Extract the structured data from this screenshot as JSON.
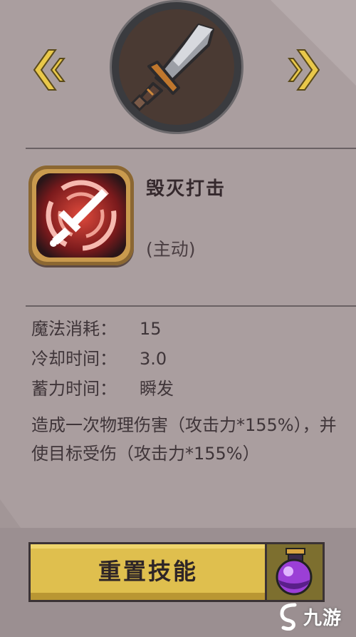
{
  "colors": {
    "background": "#aa9e9f",
    "button_gold": "#dfbf4e",
    "arrow_gold": "#e9c84a",
    "skill_red": "#c8322e"
  },
  "selector": {
    "prev_icon": "chevron-double-left-icon",
    "next_icon": "chevron-double-right-icon",
    "weapon_icon": "sword-icon"
  },
  "skill": {
    "icon": "sword-strike-icon",
    "name": "毁灭打击",
    "type": "(主动)"
  },
  "stats": [
    {
      "label": "魔法消耗：",
      "value": "15"
    },
    {
      "label": "冷却时间：",
      "value": "3.0"
    },
    {
      "label": "蓄力时间：",
      "value": "瞬发"
    }
  ],
  "description": "造成一次物理伤害（攻击力*155%），并使目标受伤（攻击力*155%）",
  "actions": {
    "reset_label": "重置技能",
    "potion_icon": "potion-icon"
  },
  "watermark": {
    "text": "九游",
    "logo_icon": "jiuyou-logo-icon"
  }
}
